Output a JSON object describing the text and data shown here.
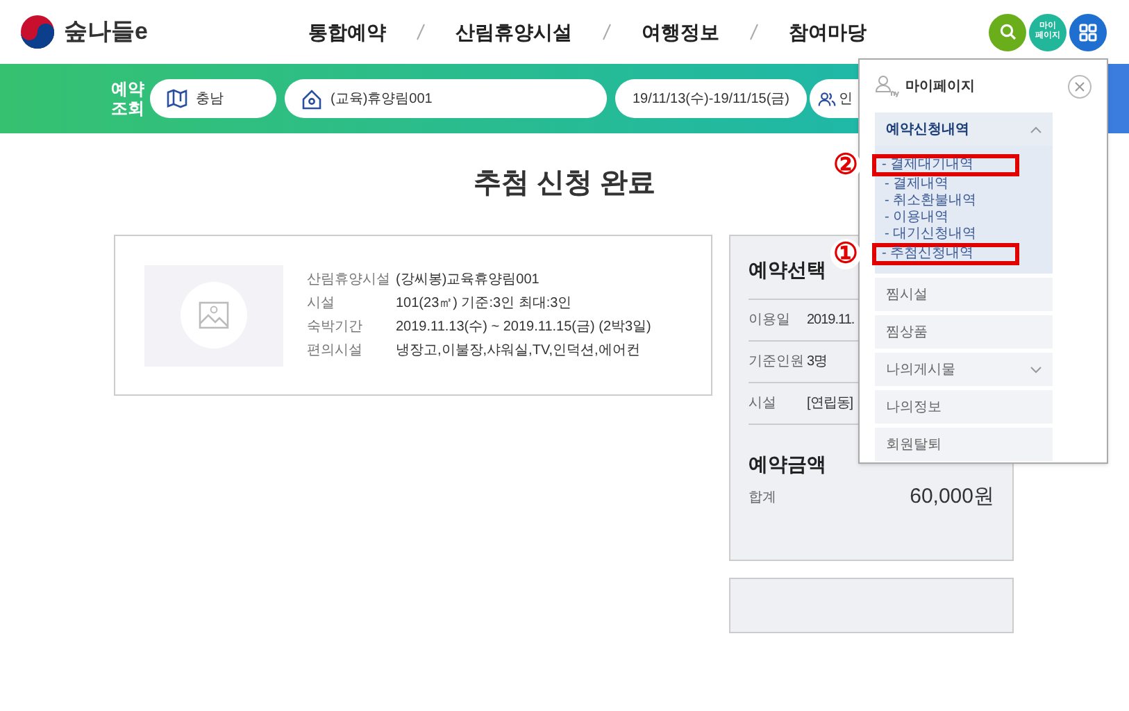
{
  "header": {
    "logo_text": "숲나들e",
    "nav": [
      "통합예약",
      "산림휴양시설",
      "여행정보",
      "참여마당"
    ],
    "my_page_button": "마이\n페이지"
  },
  "search_bar": {
    "label": "예약\n조회",
    "fields": [
      {
        "kind": "region",
        "value": "충남"
      },
      {
        "kind": "place",
        "value": "(교육)휴양림001"
      },
      {
        "kind": "date",
        "value": "19/11/13(수)-19/11/15(금)"
      },
      {
        "kind": "people",
        "value": "인"
      }
    ]
  },
  "page_title": "추첨 신청 완료",
  "facility_card": {
    "rows": [
      {
        "label": "산림휴양시설",
        "value": "(강씨봉)교육휴양림001"
      },
      {
        "label": "시설",
        "value": "101(23㎡) 기준:3인 최대:3인"
      },
      {
        "label": "숙박기간",
        "value": "2019.11.13(수) ~ 2019.11.15(금) (2박3일)"
      },
      {
        "label": "편의시설",
        "value": "냉장고,이불장,샤워실,TV,인덕션,에어컨"
      }
    ]
  },
  "reservation_panel": {
    "title": "예약선택",
    "rows": [
      {
        "label": "이용일",
        "value": "2019.11."
      },
      {
        "label": "기준인원",
        "value": "3명"
      },
      {
        "label": "시설",
        "value": "[연립동]"
      }
    ],
    "amount_title": "예약금액",
    "total_label": "합계",
    "total_value": "60,000원"
  },
  "my_page_menu": {
    "title": "마이페이지",
    "items": [
      {
        "label": "예약신청내역",
        "expanded": true,
        "children": [
          {
            "label": "- 결제대기내역",
            "marker": "②"
          },
          {
            "label": "- 결제내역"
          },
          {
            "label": "- 취소환불내역"
          },
          {
            "label": "- 이용내역"
          },
          {
            "label": "- 대기신청내역"
          },
          {
            "label": "- 추첨신청내역",
            "marker": "①"
          }
        ]
      },
      {
        "label": "찜시설"
      },
      {
        "label": "찜상품"
      },
      {
        "label": "나의게시물",
        "expanded": false
      },
      {
        "label": "나의정보"
      },
      {
        "label": "회원탈퇴"
      }
    ]
  }
}
